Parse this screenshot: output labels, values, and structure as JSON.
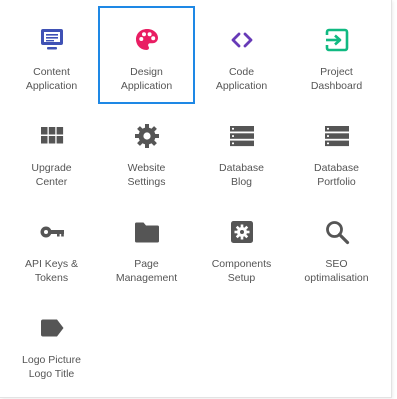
{
  "colors": {
    "blue": "#3f51b5",
    "pink": "#e91e63",
    "purple": "#673ab7",
    "teal": "#10b981",
    "grey": "#555555",
    "selection": "#1e88e5"
  },
  "tiles": [
    {
      "line1": "Content",
      "line2": "Application",
      "icon": "monitor-icon"
    },
    {
      "line1": "Design",
      "line2": "Application",
      "icon": "palette-icon",
      "selected": true
    },
    {
      "line1": "Code",
      "line2": "Application",
      "icon": "code-icon"
    },
    {
      "line1": "Project",
      "line2": "Dashboard",
      "icon": "exit-icon"
    },
    {
      "line1": "Upgrade",
      "line2": "Center",
      "icon": "grid-icon"
    },
    {
      "line1": "Website",
      "line2": "Settings",
      "icon": "gear-icon"
    },
    {
      "line1": "Database",
      "line2": "Blog",
      "icon": "database-icon"
    },
    {
      "line1": "Database",
      "line2": "Portfolio",
      "icon": "database-icon"
    },
    {
      "line1": "API Keys &",
      "line2": "Tokens",
      "icon": "key-icon"
    },
    {
      "line1": "Page",
      "line2": "Management",
      "icon": "folder-icon"
    },
    {
      "line1": "Components",
      "line2": "Setup",
      "icon": "settings-box-icon"
    },
    {
      "line1": "SEO",
      "line2": "optimalisation",
      "icon": "search-icon"
    },
    {
      "line1": "Logo Picture",
      "line2": "Logo Title",
      "icon": "label-icon"
    }
  ]
}
